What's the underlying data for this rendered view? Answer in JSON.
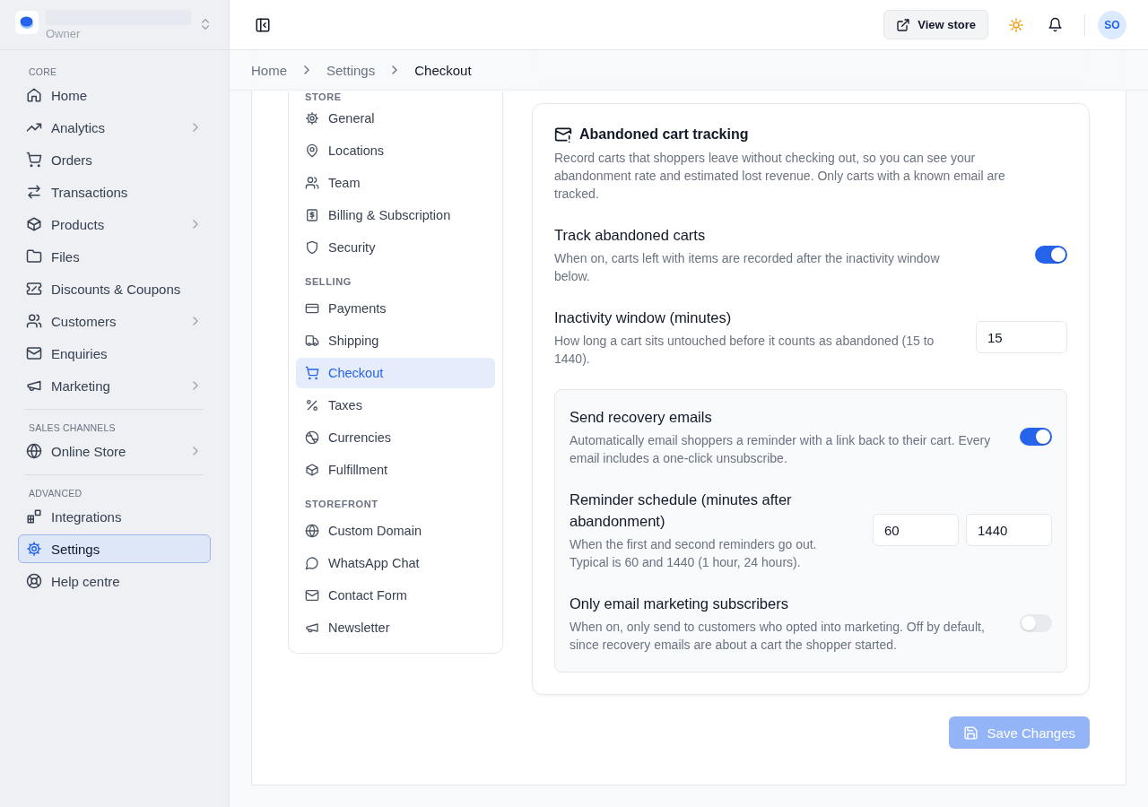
{
  "sidebar": {
    "account": {
      "role": "Owner"
    },
    "sections": [
      {
        "label": "CORE",
        "items": [
          {
            "label": "Home",
            "selected": false,
            "expandable": false
          },
          {
            "label": "Analytics",
            "selected": false,
            "expandable": true
          },
          {
            "label": "Orders",
            "selected": false,
            "expandable": false
          },
          {
            "label": "Transactions",
            "selected": false,
            "expandable": false
          },
          {
            "label": "Products",
            "selected": false,
            "expandable": true
          },
          {
            "label": "Files",
            "selected": false,
            "expandable": false
          },
          {
            "label": "Discounts & Coupons",
            "selected": false,
            "expandable": false
          },
          {
            "label": "Customers",
            "selected": false,
            "expandable": true
          },
          {
            "label": "Enquiries",
            "selected": false,
            "expandable": false
          },
          {
            "label": "Marketing",
            "selected": false,
            "expandable": true
          }
        ]
      },
      {
        "label": "SALES CHANNELS",
        "items": [
          {
            "label": "Online Store",
            "selected": false,
            "expandable": true
          }
        ]
      },
      {
        "label": "ADVANCED",
        "items": [
          {
            "label": "Integrations",
            "selected": false,
            "expandable": false
          },
          {
            "label": "Settings",
            "selected": true,
            "expandable": false
          },
          {
            "label": "Help centre",
            "selected": false,
            "expandable": false
          }
        ]
      }
    ]
  },
  "header": {
    "view_store": "View store",
    "avatar": "SO"
  },
  "breadcrumb": [
    "Home",
    "Settings",
    "Checkout"
  ],
  "settings_nav": {
    "sections": [
      {
        "label": "STORE",
        "items": [
          {
            "label": "General",
            "selected": false
          },
          {
            "label": "Locations",
            "selected": false
          },
          {
            "label": "Team",
            "selected": false
          },
          {
            "label": "Billing & Subscription",
            "selected": false
          },
          {
            "label": "Security",
            "selected": false
          }
        ]
      },
      {
        "label": "SELLING",
        "items": [
          {
            "label": "Payments",
            "selected": false
          },
          {
            "label": "Shipping",
            "selected": false
          },
          {
            "label": "Checkout",
            "selected": true
          },
          {
            "label": "Taxes",
            "selected": false
          },
          {
            "label": "Currencies",
            "selected": false
          },
          {
            "label": "Fulfillment",
            "selected": false
          }
        ]
      },
      {
        "label": "STOREFRONT",
        "items": [
          {
            "label": "Custom Domain",
            "selected": false
          },
          {
            "label": "WhatsApp Chat",
            "selected": false
          },
          {
            "label": "Contact Form",
            "selected": false
          },
          {
            "label": "Newsletter",
            "selected": false
          }
        ]
      }
    ]
  },
  "card": {
    "title": "Abandoned cart tracking",
    "description": "Record carts that shoppers leave without checking out, so you can see your abandonment rate and estimated lost revenue. Only carts with a known email are tracked.",
    "settings": [
      {
        "kind": "toggle",
        "label": "Track abandoned carts",
        "description": "When on, carts left with items are recorded after the inactivity window below.",
        "on": true
      },
      {
        "kind": "number",
        "label": "Inactivity window (minutes)",
        "description": "How long a cart sits untouched before it counts as abandoned (15 to 1440).",
        "values": [
          "15"
        ]
      }
    ],
    "recovery": [
      {
        "kind": "toggle",
        "label": "Send recovery emails",
        "description": "Automatically email shoppers a reminder with a link back to their cart. Every email includes a one-click unsubscribe.",
        "on": true
      },
      {
        "kind": "number",
        "label": "Reminder schedule (minutes after abandonment)",
        "description": "When the first and second reminders go out. Typical is 60 and 1440 (1 hour, 24 hours).",
        "values": [
          "60",
          "1440"
        ]
      },
      {
        "kind": "toggle",
        "label": "Only email marketing subscribers",
        "description": "When on, only send to customers who opted into marketing. Off by default, since recovery emails are about a cart the shopper started.",
        "on": false
      }
    ]
  },
  "save_button": {
    "label": "Save Changes",
    "disabled": true
  }
}
